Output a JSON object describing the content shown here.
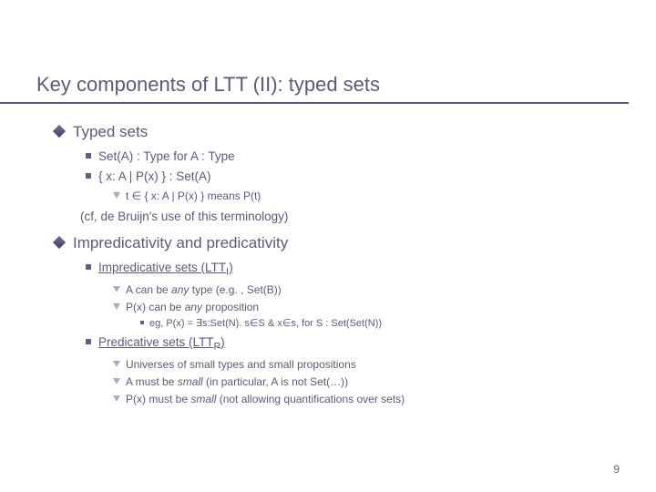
{
  "title": "Key components of LTT (II): typed sets",
  "s1": {
    "head": "Typed sets",
    "b1": "Set(A) : Type  for  A : Type",
    "b2": "{ x: A | P(x) }  :  Set(A)",
    "b2a_pre": "t ∈ { x: A | P(x) }  means  P(t)",
    "cf": "(cf, de Bruijn's use of this terminology)"
  },
  "s2": {
    "head": "Impredicativity and predicativity",
    "imp": {
      "head_pre": "Impredicative sets (LTT",
      "head_sub": "I",
      "head_post": ")",
      "a_pre": "A can be ",
      "a_em": "any",
      "a_post": " type (e.g. , Set(B))",
      "b_pre": "P(x) can be ",
      "b_em": "any",
      "b_post": " proposition",
      "eg": "eg, P(x) = ∃s:Set(N). s∈S & x∈s, for S : Set(Set(N))"
    },
    "pred": {
      "head_pre": "Predicative sets (LTT",
      "head_sub": "P",
      "head_post": ")",
      "a": "Universes of small types and small propositions",
      "b_pre": "A must be ",
      "b_em": "small",
      "b_post": "  (in particular, A is not Set(…))",
      "c_pre": "P(x) must be ",
      "c_em": "small",
      "c_post": "  (not allowing quantifications over sets)"
    }
  },
  "page": "9"
}
